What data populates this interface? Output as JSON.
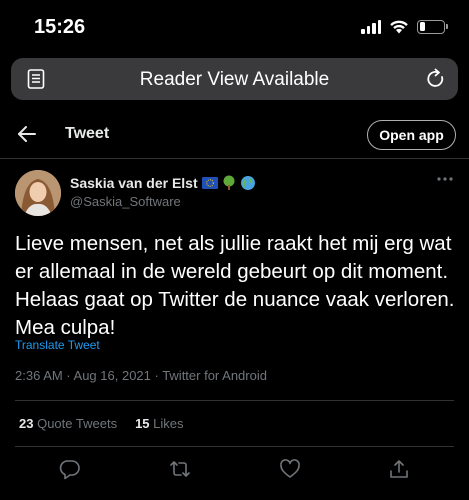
{
  "status_bar": {
    "time": "15:26",
    "battery_level": 0.25,
    "signal_bars": 4
  },
  "browser": {
    "url_text": "Reader View Available"
  },
  "header": {
    "title": "Tweet",
    "open_app_label": "Open app"
  },
  "tweet": {
    "author_name": "Saskia van der Elst",
    "author_emojis": [
      "eu-flag-icon",
      "tree-icon",
      "globe-icon"
    ],
    "handle": "@Saskia_Software",
    "text": "Lieve mensen, net als jullie raakt het mij erg wat er allemaal in de wereld gebeurt op dit moment. Helaas gaat op Twitter de nuance vaak verloren. Mea culpa!",
    "translate_label": "Translate Tweet",
    "meta": "2:36 AM · Aug 16, 2021 · Twitter for Android",
    "quote_tweets_count": "23",
    "quote_tweets_label": "Quote Tweets",
    "likes_count": "15",
    "likes_label": "Likes"
  },
  "actions": [
    "reply-icon",
    "retweet-icon",
    "like-icon",
    "share-icon"
  ],
  "colors": {
    "background": "#000000",
    "link": "#1d9bf0",
    "secondary_text": "#71767b",
    "divider": "#2f3336"
  }
}
